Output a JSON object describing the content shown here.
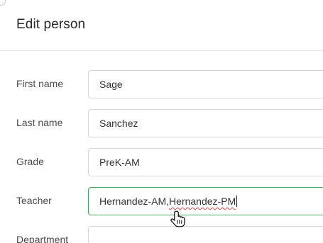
{
  "dialog": {
    "title": "Edit person"
  },
  "fields": {
    "first_name": {
      "label": "First name",
      "value": "Sage"
    },
    "last_name": {
      "label": "Last name",
      "value": "Sanchez"
    },
    "grade": {
      "label": "Grade",
      "value": "PreK-AM"
    },
    "teacher": {
      "label": "Teacher",
      "value_part1": "Hernandez-AM,",
      "value_part2": "Hernandez-PM"
    },
    "department": {
      "label": "Department",
      "value": ""
    }
  },
  "colors": {
    "focus_border": "#3aa85f",
    "spellcheck": "#e04a4a"
  },
  "icons": {
    "cursor": "hand-pointer-icon"
  }
}
